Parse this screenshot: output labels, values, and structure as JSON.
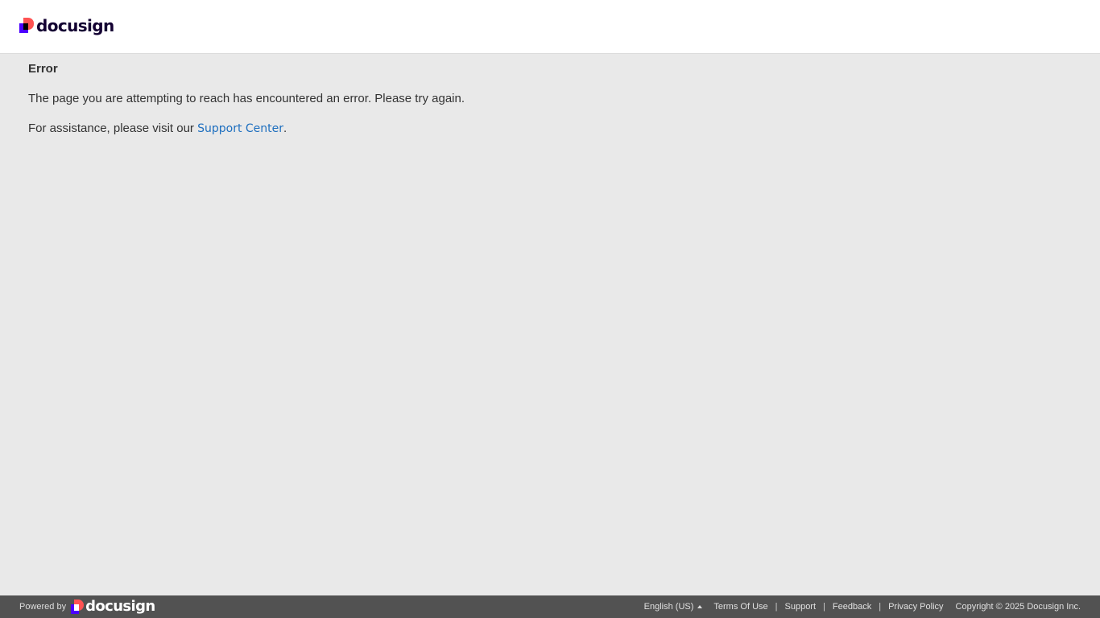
{
  "header": {
    "logo_text": "docusign"
  },
  "content": {
    "title": "Error",
    "message": "The page you are attempting to reach has encountered an error. Please try again.",
    "assist_prefix": "For assistance, please visit our ",
    "support_link": "Support Center",
    "assist_suffix": "."
  },
  "footer": {
    "powered_by": "Powered by",
    "logo_text": "docusign",
    "language": "English (US)",
    "links": [
      "Terms Of Use",
      "Support",
      "Feedback",
      "Privacy Policy"
    ],
    "separator": "|",
    "copyright": "Copyright © 2025 Docusign Inc."
  },
  "colors": {
    "link": "#1e6fbf",
    "footer_bg": "#525252",
    "page_bg": "#e9e9e9",
    "logo_red": "#ff5252",
    "logo_purple": "#4c00ff"
  }
}
